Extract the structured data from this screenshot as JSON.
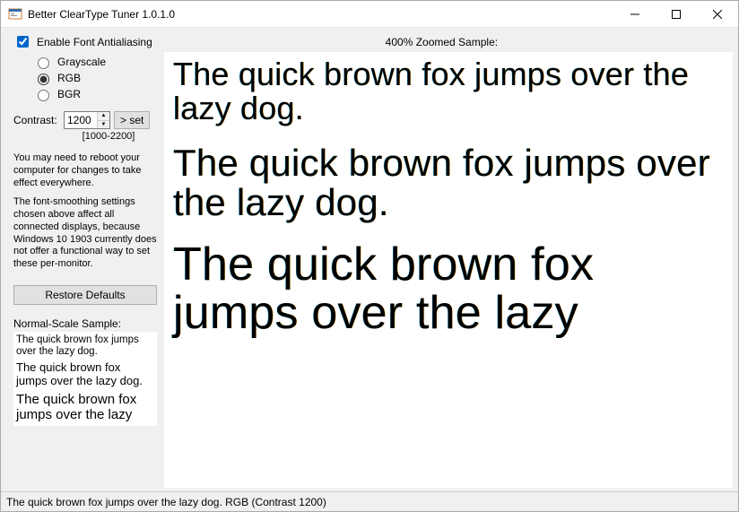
{
  "window": {
    "title": "Better ClearType Tuner 1.0.1.0"
  },
  "controls": {
    "enable_antialias_label": "Enable Font Antialiasing",
    "enable_antialias_checked": true,
    "radios": {
      "grayscale": "Grayscale",
      "rgb": "RGB",
      "bgr": "BGR",
      "selected": "rgb"
    },
    "contrast_label": "Contrast:",
    "contrast_value": "1200",
    "contrast_range": "[1000-2200]",
    "set_button": "> set",
    "info1": "You may need to reboot your computer for changes to take effect everywhere.",
    "info2": "The font-smoothing settings chosen above affect all connected displays, because Windows 10 1903 currently does not offer a functional way to set these per-monitor.",
    "restore_button": "Restore Defaults",
    "normal_sample_label": "Normal-Scale Sample:"
  },
  "zoom_label": "400% Zoomed Sample:",
  "sample_text": {
    "line1": "The quick brown fox jumps over the lazy dog.",
    "line2": "The quick brown fox jumps over the lazy dog.",
    "line3": "The quick brown fox jumps over the lazy"
  },
  "statusbar": "The quick brown fox jumps over the lazy dog. RGB (Contrast 1200)"
}
